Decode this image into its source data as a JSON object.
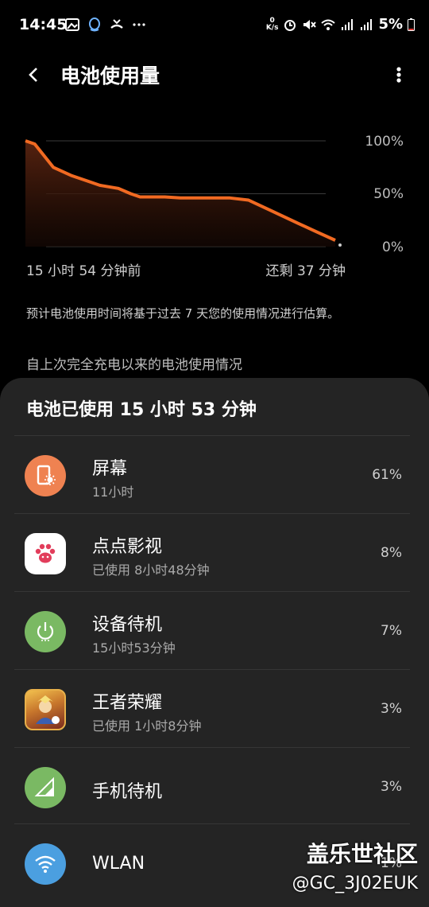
{
  "status_bar": {
    "time": "14:45",
    "net_speed_top": "0",
    "net_speed_bottom": "K/s",
    "battery_percent": "5%",
    "left_icons": [
      "image-icon",
      "qq-icon",
      "missed-call-icon",
      "more-dots-icon"
    ],
    "right_icons": [
      "alarm-icon",
      "mute-icon",
      "wifi-icon",
      "signal-4g-icon",
      "signal-4g-icon",
      "battery-icon"
    ]
  },
  "header": {
    "title": "电池使用量",
    "back_icon": "back-arrow-icon",
    "more_icon": "more-vert-icon"
  },
  "chart_data": {
    "type": "area",
    "y_tick_labels": [
      "100%",
      "50%",
      "0%"
    ],
    "ylim": [
      0,
      100
    ],
    "x_start_label": "15 小时 54 分钟前",
    "x_end_label": "还剩 37 分钟",
    "line_color": "#f16a22",
    "x": [
      0,
      0.03,
      0.09,
      0.15,
      0.2,
      0.24,
      0.3,
      0.34,
      0.37,
      0.45,
      0.5,
      0.58,
      0.66,
      0.72,
      0.8,
      0.88,
      0.94,
      1.0
    ],
    "y": [
      100,
      97,
      75,
      67,
      62,
      58,
      55,
      50,
      47,
      47,
      46,
      46,
      46,
      44,
      33,
      22,
      14,
      6
    ],
    "projected_end": 0
  },
  "chart_labels": {
    "time_left": "15 小时 54 分钟前",
    "time_right": "还剩 37 分钟",
    "estimate_note": "预计电池使用时间将基于过去 7 天您的使用情况进行估算。",
    "since_full_charge": "自上次完全充电以来的电池使用情况"
  },
  "usage": {
    "title": "电池已使用 15 小时 53 分钟",
    "items": [
      {
        "name": "屏幕",
        "sub": "11小时",
        "pct": "61%",
        "icon": "screen-brightness-icon",
        "color": "#ef8251"
      },
      {
        "name": "点点影视",
        "sub": "已使用 8小时48分钟",
        "pct": "8%",
        "icon": "paw-icon",
        "color": "#ffffff"
      },
      {
        "name": "设备待机",
        "sub": "15小时53分钟",
        "pct": "7%",
        "icon": "power-standby-icon",
        "color": "#7ab963"
      },
      {
        "name": "王者荣耀",
        "sub": "已使用 1小时8分钟",
        "pct": "3%",
        "icon": "game-avatar-icon",
        "color": "#c7762c"
      },
      {
        "name": "手机待机",
        "sub": "",
        "pct": "3%",
        "icon": "cell-signal-icon",
        "color": "#7ab963"
      },
      {
        "name": "WLAN",
        "sub": "",
        "pct": "1%",
        "icon": "wifi-icon",
        "color": "#4b9fe0"
      }
    ]
  },
  "watermark": {
    "line1": "盖乐世社区",
    "line2": "@GC_3J02EUK"
  }
}
